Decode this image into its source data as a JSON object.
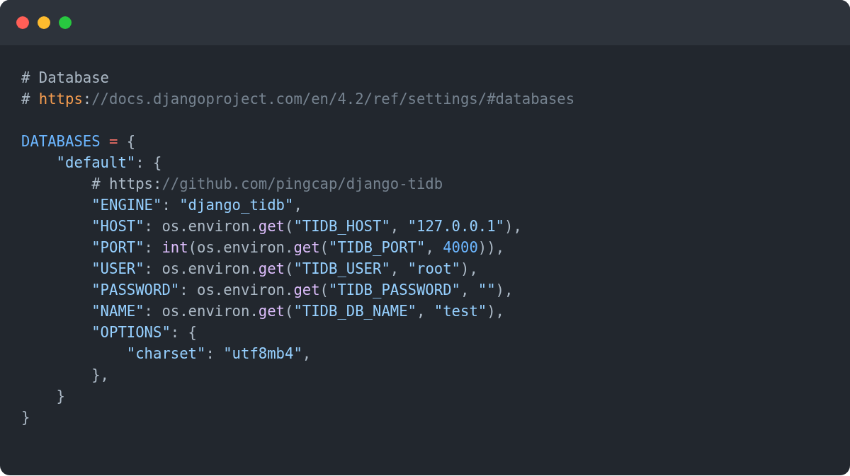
{
  "window": {
    "controls": [
      {
        "color": "#ff5f57"
      },
      {
        "color": "#febc2e"
      },
      {
        "color": "#28c840"
      }
    ]
  },
  "code": {
    "lines": [
      {
        "kind": "code",
        "tokens": [
          {
            "text": "# Database",
            "kind": "comment"
          }
        ]
      },
      {
        "kind": "code",
        "tokens": [
          {
            "text": "# ",
            "kind": "comment"
          },
          {
            "text": "https",
            "kind": "scheme"
          },
          {
            "text": ":",
            "kind": "comment"
          },
          {
            "text": "//docs.djangoproject.com/en/4.2/ref/settings/#databases",
            "kind": "comment_dim"
          }
        ]
      },
      {
        "kind": "blank"
      },
      {
        "kind": "code",
        "tokens": [
          {
            "text": "DATABASES ",
            "kind": "variable"
          },
          {
            "text": "=",
            "kind": "operator"
          },
          {
            "text": " {",
            "kind": "plain"
          }
        ]
      },
      {
        "kind": "code",
        "tokens": [
          {
            "text": "    \"default\"",
            "kind": "string"
          },
          {
            "text": ": {",
            "kind": "plain"
          }
        ]
      },
      {
        "kind": "code",
        "tokens": [
          {
            "text": "        # https:",
            "kind": "comment"
          },
          {
            "text": "//github.com/pingcap/django-tidb",
            "kind": "comment_dim"
          }
        ]
      },
      {
        "kind": "code",
        "tokens": [
          {
            "text": "        \"ENGINE\"",
            "kind": "string"
          },
          {
            "text": ": ",
            "kind": "plain"
          },
          {
            "text": "\"django_tidb\"",
            "kind": "string"
          },
          {
            "text": ",",
            "kind": "plain"
          }
        ]
      },
      {
        "kind": "code",
        "tokens": [
          {
            "text": "        \"HOST\"",
            "kind": "string"
          },
          {
            "text": ": os.environ.",
            "kind": "plain"
          },
          {
            "text": "get",
            "kind": "function"
          },
          {
            "text": "(",
            "kind": "plain"
          },
          {
            "text": "\"TIDB_HOST\"",
            "kind": "string"
          },
          {
            "text": ", ",
            "kind": "plain"
          },
          {
            "text": "\"127.0.0.1\"",
            "kind": "string"
          },
          {
            "text": "),",
            "kind": "plain"
          }
        ]
      },
      {
        "kind": "code",
        "tokens": [
          {
            "text": "        \"PORT\"",
            "kind": "string"
          },
          {
            "text": ": ",
            "kind": "plain"
          },
          {
            "text": "int",
            "kind": "function"
          },
          {
            "text": "(os.environ.",
            "kind": "plain"
          },
          {
            "text": "get",
            "kind": "function"
          },
          {
            "text": "(",
            "kind": "plain"
          },
          {
            "text": "\"TIDB_PORT\"",
            "kind": "string"
          },
          {
            "text": ", ",
            "kind": "plain"
          },
          {
            "text": "4000",
            "kind": "number"
          },
          {
            "text": ")),",
            "kind": "plain"
          }
        ]
      },
      {
        "kind": "code",
        "tokens": [
          {
            "text": "        \"USER\"",
            "kind": "string"
          },
          {
            "text": ": os.environ.",
            "kind": "plain"
          },
          {
            "text": "get",
            "kind": "function"
          },
          {
            "text": "(",
            "kind": "plain"
          },
          {
            "text": "\"TIDB_USER\"",
            "kind": "string"
          },
          {
            "text": ", ",
            "kind": "plain"
          },
          {
            "text": "\"root\"",
            "kind": "string"
          },
          {
            "text": "),",
            "kind": "plain"
          }
        ]
      },
      {
        "kind": "code",
        "tokens": [
          {
            "text": "        \"PASSWORD\"",
            "kind": "string"
          },
          {
            "text": ": os.environ.",
            "kind": "plain"
          },
          {
            "text": "get",
            "kind": "function"
          },
          {
            "text": "(",
            "kind": "plain"
          },
          {
            "text": "\"TIDB_PASSWORD\"",
            "kind": "string"
          },
          {
            "text": ", ",
            "kind": "plain"
          },
          {
            "text": "\"\"",
            "kind": "string"
          },
          {
            "text": "),",
            "kind": "plain"
          }
        ]
      },
      {
        "kind": "code",
        "tokens": [
          {
            "text": "        \"NAME\"",
            "kind": "string"
          },
          {
            "text": ": os.environ.",
            "kind": "plain"
          },
          {
            "text": "get",
            "kind": "function"
          },
          {
            "text": "(",
            "kind": "plain"
          },
          {
            "text": "\"TIDB_DB_NAME\"",
            "kind": "string"
          },
          {
            "text": ", ",
            "kind": "plain"
          },
          {
            "text": "\"test\"",
            "kind": "string"
          },
          {
            "text": "),",
            "kind": "plain"
          }
        ]
      },
      {
        "kind": "code",
        "tokens": [
          {
            "text": "        \"OPTIONS\"",
            "kind": "string"
          },
          {
            "text": ": {",
            "kind": "plain"
          }
        ]
      },
      {
        "kind": "code",
        "tokens": [
          {
            "text": "            \"charset\"",
            "kind": "string"
          },
          {
            "text": ": ",
            "kind": "plain"
          },
          {
            "text": "\"utf8mb4\"",
            "kind": "string"
          },
          {
            "text": ",",
            "kind": "plain"
          }
        ]
      },
      {
        "kind": "code",
        "tokens": [
          {
            "text": "        },",
            "kind": "plain"
          }
        ]
      },
      {
        "kind": "code",
        "tokens": [
          {
            "text": "    }",
            "kind": "plain"
          }
        ]
      },
      {
        "kind": "code",
        "tokens": [
          {
            "text": "}",
            "kind": "plain"
          }
        ]
      }
    ]
  }
}
